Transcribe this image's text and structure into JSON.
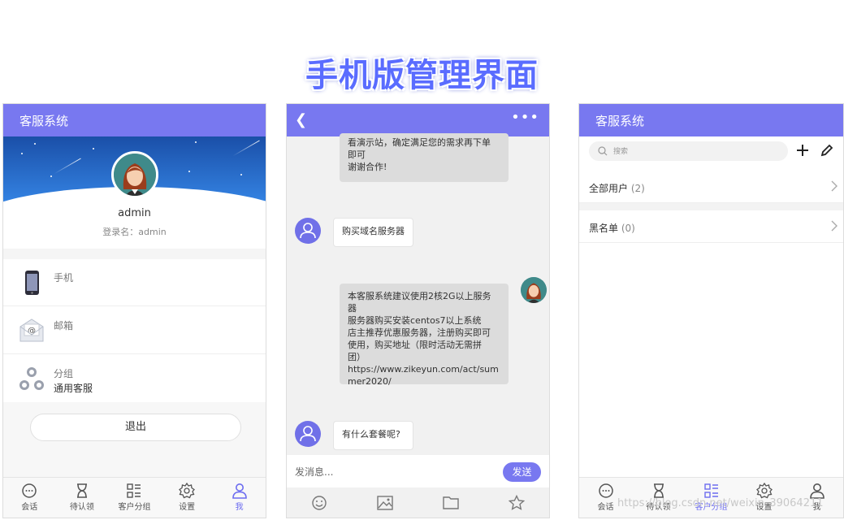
{
  "banner": "手机版管理界面",
  "profile": {
    "title": "客服系统",
    "name": "admin",
    "login": "登录名：admin",
    "phone_label": "手机",
    "email_label": "邮箱",
    "group_label": "分组",
    "group_value": "通用客服",
    "logout": "退出"
  },
  "tabs": [
    "会话",
    "待认领",
    "客户分组",
    "设置",
    "我"
  ],
  "chat": {
    "msg1_lines": [
      "看演示站，确定满足您的需求再下单",
      "即可",
      "谢谢合作!"
    ],
    "msg2": "购买域名服务器",
    "msg3_lines": [
      "本客服系统建议使用2核2G以上服务",
      "器",
      "服务器购买安装centos7以上系统",
      "店主推荐优惠服务器，注册购买即可",
      "使用，购买地址（限时活动无需拼",
      "团）https://www.zikeyun.com/act/sum",
      "mer2020/"
    ],
    "msg4": "有什么套餐呢?",
    "input_placeholder": "发消息...",
    "send": "发送"
  },
  "groups": {
    "title": "客服系统",
    "search_placeholder": "搜索",
    "all_users": "全部用户",
    "all_users_count": "(2)",
    "blacklist": "黑名单",
    "blacklist_count": "(0)"
  },
  "watermark": "https://blog.csdn.net/weixin_39064211",
  "colors": {
    "accent": "#7878f0",
    "active_tab": "#6c6cf0"
  }
}
